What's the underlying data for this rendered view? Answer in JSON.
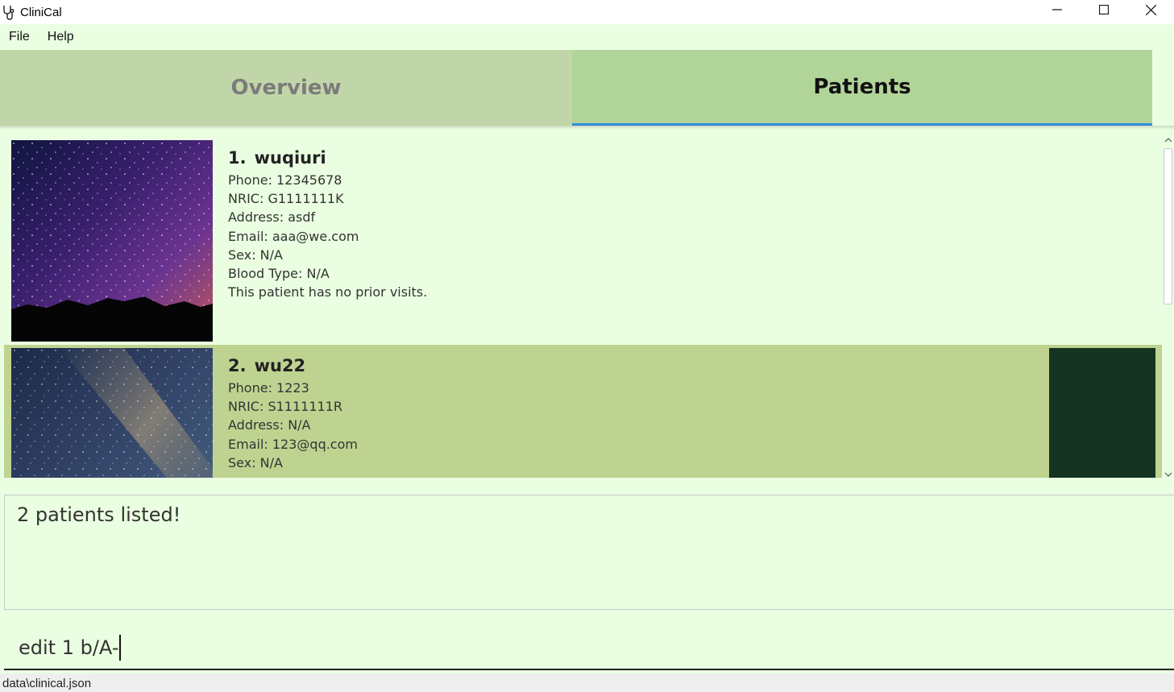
{
  "window": {
    "title": "CliniCal",
    "icon": "stethoscope-icon",
    "controls": [
      "minimize-icon",
      "maximize-icon",
      "close-icon"
    ]
  },
  "menu": {
    "file": "File",
    "help": "Help"
  },
  "tabs": [
    {
      "label": "Overview",
      "selected": false
    },
    {
      "label": "Patients",
      "selected": true
    }
  ],
  "patients": [
    {
      "index": "1.",
      "name": "wuqiuri",
      "photo": "night-sky-mountains",
      "fields": [
        "Phone: 12345678",
        "NRIC: G1111111K",
        "Address: asdf",
        "Email: aaa@we.com",
        "Sex: N/A",
        "Blood Type: N/A",
        "This patient has no prior visits."
      ]
    },
    {
      "index": "2.",
      "name": "wu22",
      "photo": "milky-way",
      "fields": [
        "Phone: 1223",
        "NRIC: S1111111R",
        "Address: N/A",
        "Email: 123@qq.com",
        "Sex: N/A"
      ]
    }
  ],
  "result": {
    "text": "2 patients listed!"
  },
  "command": {
    "value": "edit 1 b/A-"
  },
  "status": {
    "path": "data\\clinical.json"
  },
  "colors": {
    "background": "#eaffe1",
    "tab_selected": "#b1d598",
    "tab_unselected": "#c0d6a8",
    "selected_card": "#bfd391",
    "tab_underline": "#2f8fd8",
    "dark_panel": "#163322"
  }
}
